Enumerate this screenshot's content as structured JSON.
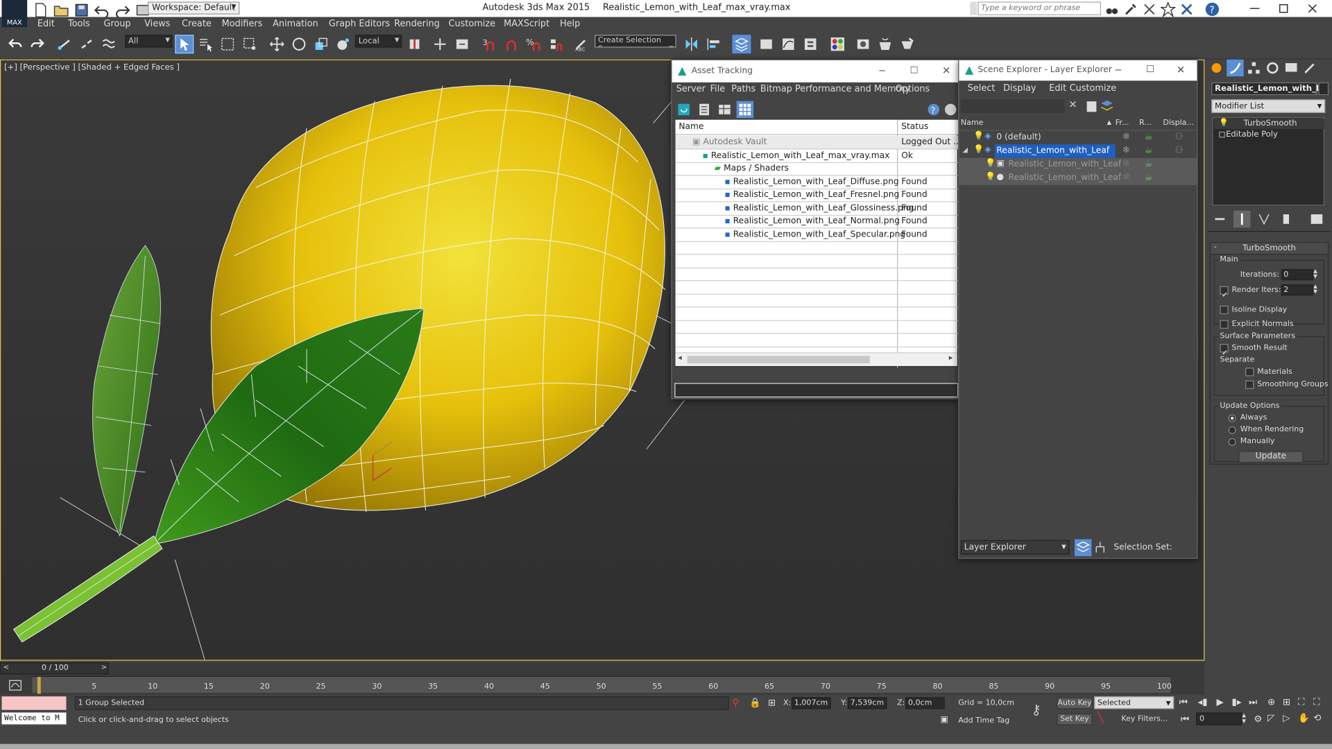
{
  "titlebar": {
    "workspace": "Workspace: Default",
    "app_title": "Autodesk 3ds Max  2015",
    "file_name": "Realistic_Lemon_with_Leaf_max_vray.max",
    "search_placeholder": "Type a keyword or phrase",
    "max_logo": "MAX"
  },
  "menu": [
    "Edit",
    "Tools",
    "Group",
    "Views",
    "Create",
    "Modifiers",
    "Animation",
    "Graph Editors",
    "Rendering",
    "Customize",
    "MAXScript",
    "Help"
  ],
  "toolbar": {
    "filter_value": "All",
    "ref_coord_value": "Local",
    "selection_set_placeholder": "Create Selection Se"
  },
  "viewport": {
    "label": "[+] [Perspective ] [Shaded + Edged Faces ]"
  },
  "asset_tracking": {
    "title": "Asset Tracking",
    "menu": [
      "Server",
      "File",
      "Paths",
      "Bitmap Performance and Memory",
      "Options"
    ],
    "columns": [
      "Name",
      "Status"
    ],
    "rows": [
      {
        "name": "Autodesk Vault",
        "status": "Logged Out ..."
      },
      {
        "name": "Realistic_Lemon_with_Leaf_max_vray.max",
        "status": "Ok"
      },
      {
        "name": "Maps / Shaders",
        "status": ""
      },
      {
        "name": "Realistic_Lemon_with_Leaf_Diffuse.png",
        "status": "Found"
      },
      {
        "name": "Realistic_Lemon_with_Leaf_Fresnel.png",
        "status": "Found"
      },
      {
        "name": "Realistic_Lemon_with_Leaf_Glossiness.png",
        "status": "Found"
      },
      {
        "name": "Realistic_Lemon_with_Leaf_Normal.png",
        "status": "Found"
      },
      {
        "name": "Realistic_Lemon_with_Leaf_Specular.png",
        "status": "Found"
      }
    ]
  },
  "scene_explorer": {
    "title": "Scene Explorer - Layer Explorer",
    "menu": [
      "Select",
      "Display",
      "Edit",
      "Customize"
    ],
    "columns": [
      "Name",
      "Fr...",
      "R...",
      "Displa..."
    ],
    "rows": [
      {
        "name": "0 (default)"
      },
      {
        "name": "Realistic_Lemon_with_Leaf"
      },
      {
        "name": "Realistic_Lemon_with_Leaf"
      },
      {
        "name": "Realistic_Lemon_with_Leaf"
      }
    ],
    "footer_dropdown": "Layer Explorer",
    "selection_set_label": "Selection Set:"
  },
  "command_panel": {
    "object_name": "Realistic_Lemon_with_Le",
    "modifier_list": "Modifier List",
    "stack": [
      "TurboSmooth",
      "Editable Poly"
    ],
    "rollout_title": "TurboSmooth",
    "main_group": "Main",
    "iterations_label": "Iterations:",
    "iterations_value": "0",
    "render_iters_label": "Render Iters:",
    "render_iters_value": "2",
    "isoline_label": "Isoline Display",
    "explicit_normals_label": "Explicit Normals",
    "surface_params_label": "Surface Parameters",
    "smooth_result_label": "Smooth Result",
    "separate_label": "Separate",
    "materials_label": "Materials",
    "smoothing_groups_label": "Smoothing Groups",
    "update_options_label": "Update Options",
    "always_label": "Always",
    "when_rendering_label": "When Rendering",
    "manually_label": "Manually",
    "update_button": "Update"
  },
  "timeline": {
    "frame_counter": "0 / 100",
    "ticks": [
      "5",
      "10",
      "15",
      "20",
      "25",
      "30",
      "35",
      "40",
      "45",
      "50",
      "55",
      "60",
      "65",
      "70",
      "75",
      "80",
      "85",
      "90",
      "95",
      "100"
    ]
  },
  "status": {
    "selection_info": "1 Group Selected",
    "prompt": "Click or click-and-drag to select objects",
    "welcome": "Welcome to M",
    "x_label": "X:",
    "x_value": "1,007cm",
    "y_label": "Y:",
    "y_value": "7,539cm",
    "z_label": "Z:",
    "z_value": "0,0cm",
    "grid": "Grid = 10,0cm",
    "add_time_tag": "Add Time Tag",
    "auto_key": "Auto Key",
    "set_key": "Set Key",
    "selected_dropdown": "Selected",
    "key_filters": "Key Filters...",
    "frame_field": "0"
  }
}
